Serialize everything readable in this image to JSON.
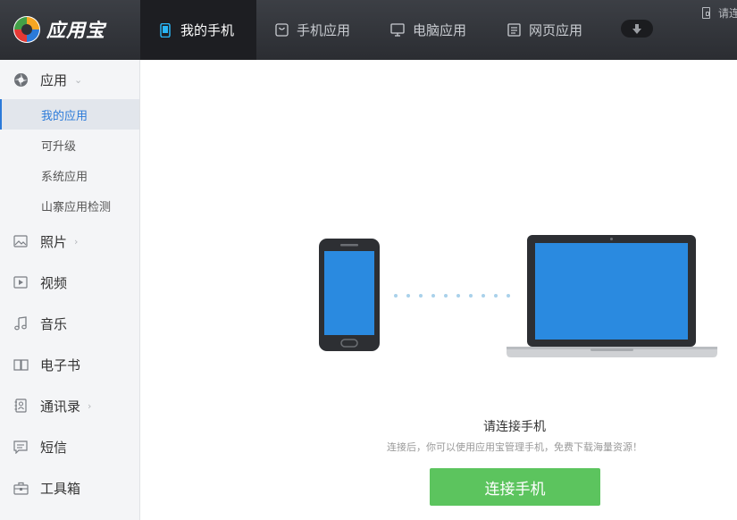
{
  "app": {
    "name": "应用宝"
  },
  "header": {
    "tabs": [
      {
        "label": "我的手机",
        "icon": "phone-icon",
        "active": true
      },
      {
        "label": "手机应用",
        "icon": "bag-icon",
        "active": false
      },
      {
        "label": "电脑应用",
        "icon": "monitor-icon",
        "active": false
      },
      {
        "label": "网页应用",
        "icon": "web-page-icon",
        "active": false
      }
    ],
    "download_icon": "download-arrow-icon",
    "connect_hint": "请连接手机"
  },
  "sidebar": {
    "sections": [
      {
        "label": "应用",
        "icon": "app-icon",
        "expandable": true,
        "expanded": true
      },
      {
        "label": "照片",
        "icon": "photo-icon",
        "expandable": true
      },
      {
        "label": "视频",
        "icon": "video-icon",
        "expandable": false
      },
      {
        "label": "音乐",
        "icon": "music-icon",
        "expandable": false
      },
      {
        "label": "电子书",
        "icon": "ebook-icon",
        "expandable": false
      },
      {
        "label": "通讯录",
        "icon": "contacts-icon",
        "expandable": true
      },
      {
        "label": "短信",
        "icon": "sms-icon",
        "expandable": false
      },
      {
        "label": "工具箱",
        "icon": "toolbox-icon",
        "expandable": false
      }
    ],
    "app_subitems": [
      {
        "label": "我的应用",
        "active": true
      },
      {
        "label": "可升级",
        "active": false
      },
      {
        "label": "系统应用",
        "active": false
      },
      {
        "label": "山寨应用检测",
        "active": false
      }
    ]
  },
  "main": {
    "title": "请连接手机",
    "subtitle": "连接后，你可以使用应用宝管理手机，免费下载海量资源！",
    "connect_button": "连接手机"
  },
  "colors": {
    "topbar": "#2f3136",
    "active_tab": "#1d1e22",
    "accent_blue": "#2b7ad9",
    "screen_blue": "#2a8ae0",
    "connect_green": "#5cc45e",
    "dot_blue": "#a9d1ea"
  }
}
